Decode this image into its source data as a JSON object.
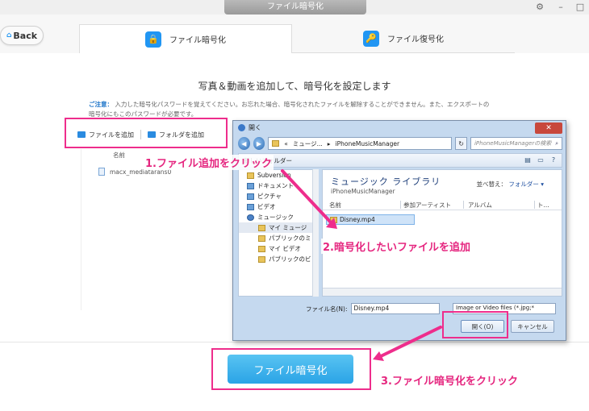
{
  "app": {
    "title": "ファイル暗号化",
    "back_label": "Back",
    "window_controls": [
      "⚙",
      "–",
      "□"
    ],
    "tabs": [
      {
        "label": "ファイル暗号化",
        "icon": "lock-icon"
      },
      {
        "label": "ファイル復号化",
        "icon": "key-icon"
      }
    ],
    "heading": "写真＆動画を追加して、暗号化を設定します",
    "notice_label": "ご注意：",
    "notice_text": "入力した暗号化パスワードを覚えてください。お忘れた場合、暗号化されたファイルを解除することができません。また、エクスポートの暗号化にもこのパスワードが必要です。",
    "toolbar": {
      "add_file": "ファイルを追加",
      "add_folder": "フォルダを追加"
    },
    "list": {
      "column_name": "名前",
      "file": "macx_mediatarans0"
    },
    "encrypt_button": "ファイル暗号化"
  },
  "dialog": {
    "title": "開く",
    "close": "✕",
    "breadcrumb_prefix": "«",
    "breadcrumb_1": "ミュージ...",
    "breadcrumb_sep": "▸",
    "breadcrumb_2": "iPhoneMusicManager",
    "search_placeholder": "iPhoneMusicManagerの検索",
    "new_folder": "新しいフォルダー",
    "nav_items": [
      "Subversion",
      "ドキュメント",
      "ピクチャ",
      "ビデオ",
      "ミュージック",
      "マイ ミュージ",
      "パブリックのミ",
      "マイ ビデオ",
      "パブリックのビ"
    ],
    "library_title": "ミュージック ライブラリ",
    "library_sub": "iPhoneMusicManager",
    "sort_label": "並べ替え：",
    "sort_value": "フォルダー ▾",
    "columns": [
      "名前",
      "参加アーティスト",
      "アルバム",
      "ト..."
    ],
    "selected_file": "Disney.mp4",
    "filename_label": "ファイル名(N):",
    "filename_value": "Disney.mp4",
    "filter_value": "Image or Video files (*.jpg;*",
    "open_button": "開く(O)",
    "cancel_button": "キャンセル"
  },
  "callouts": {
    "step1": "1.ファイル追加をクリック",
    "step2": "2.暗号化したいファイルを追加",
    "step3": "3.ファイル暗号化をクリック"
  },
  "colors": {
    "accent": "#2196f3",
    "callout": "#ee2d8c",
    "encrypt_button": "#2aa3e6"
  }
}
